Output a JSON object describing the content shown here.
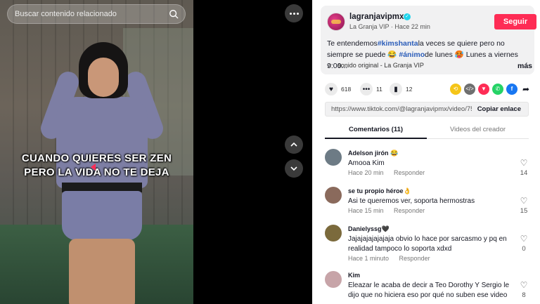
{
  "search": {
    "placeholder": "Buscar contenido relacionado"
  },
  "video": {
    "caption_line1": "CUANDO QUIERES SER ZEN",
    "caption_line2": "PERO LA VIDA NO TE DEJA"
  },
  "post": {
    "username": "lagranjavipmx",
    "source": "La Granja VIP",
    "time": "Hace 22 min",
    "follow_label": "Seguir",
    "desc_part1": "Te entendemos",
    "desc_tag1": "#kimshanta",
    "desc_part2": "la veces se quiere pero no siempre se puede 😂 ",
    "desc_tag2": "#ánimo",
    "desc_part3": "de lunes 🥵  Lunes a viernes 9:00...",
    "more_label": "más",
    "music": "sonido original - La Granja VIP"
  },
  "actions": {
    "likes": "618",
    "comments": "11",
    "saves": "12"
  },
  "share_colors": {
    "repost": "#f5c518",
    "embed": "#6f6f6f",
    "send": "#fe2c55",
    "whatsapp": "#25d366",
    "facebook": "#1877f2"
  },
  "link": {
    "url": "https://www.tiktok.com/@lagranjavipmx/video/75...",
    "copy_label": "Copiar enlace"
  },
  "tabs": {
    "comments": "Comentarios (11)",
    "creator_videos": "Videos del creador"
  },
  "comments": [
    {
      "name": "Adelson jirón 😂",
      "text": "Amooa Kim",
      "time": "Hace 20 min",
      "reply": "Responder",
      "likes": "14",
      "avatar_color": "#6d7b85"
    },
    {
      "name": "se tu propio héroe👌",
      "text": "Asi te queremos ver, soporta hermostras",
      "time": "Hace 15 min",
      "reply": "Responder",
      "likes": "15",
      "avatar_color": "#8a6a5c"
    },
    {
      "name": "Danielyssg🖤",
      "text": "Jajajajajajajaja obvio lo hace por sarcasmo y pq en realidad tampoco lo soporta xdxd",
      "time": "Hace 1 minuto",
      "reply": "Responder",
      "likes": "0",
      "avatar_color": "#7b6a3c"
    },
    {
      "name": "Kim",
      "text": "Eleazar le acaba de decir a Teo Dorothy Y Sergio le dijo que no hiciera eso por qué no suben ese video",
      "time": "",
      "reply": "",
      "likes": "8",
      "avatar_color": "#c7a4a8"
    }
  ]
}
